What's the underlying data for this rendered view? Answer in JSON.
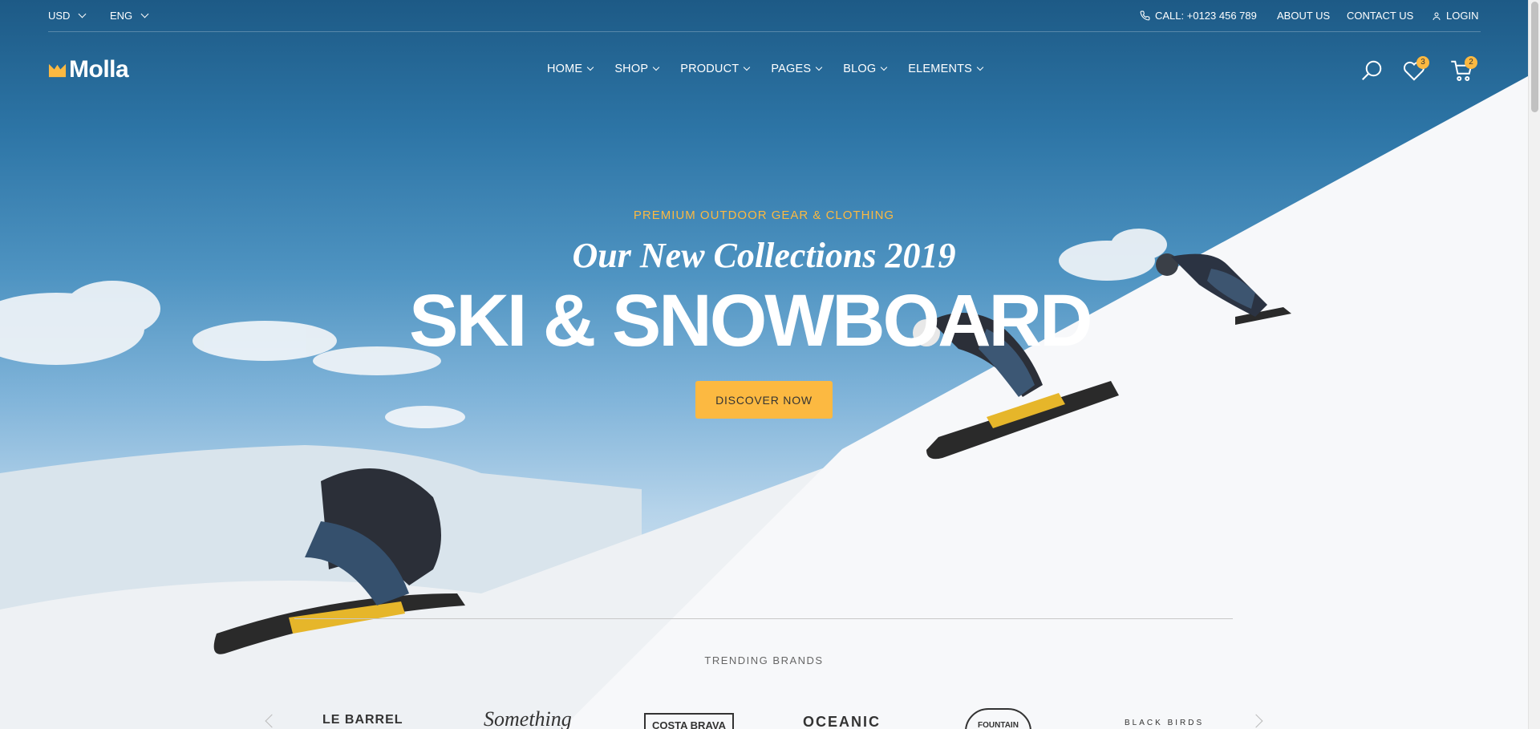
{
  "topbar": {
    "currency": "USD",
    "language": "ENG",
    "phone": "CALL: +0123 456 789",
    "about": "ABOUT US",
    "contact": "CONTACT US",
    "login": "LOGIN"
  },
  "header": {
    "logo_text": "Molla",
    "nav": [
      {
        "label": "HOME"
      },
      {
        "label": "SHOP"
      },
      {
        "label": "PRODUCT"
      },
      {
        "label": "PAGES"
      },
      {
        "label": "BLOG"
      },
      {
        "label": "ELEMENTS"
      }
    ],
    "wishlist_count": "3",
    "cart_count": "2"
  },
  "hero": {
    "eyebrow": "PREMIUM OUTDOOR GEAR & CLOTHING",
    "subtitle": "Our New Collections 2019",
    "headline": "SKI & SNOWBOARD",
    "cta": "DISCOVER NOW"
  },
  "brands": {
    "title": "TRENDING BRANDS",
    "items": [
      "LE BARREL",
      "Something",
      "COSTA BRAVA",
      "OCEANIC",
      "FOUNTAIN",
      "BLACK BIRDS"
    ]
  },
  "colors": {
    "accent": "#fcb941",
    "sky": "#1d5a86"
  },
  "icons": [
    "phone-icon",
    "user-icon",
    "search-icon",
    "heart-icon",
    "cart-icon",
    "chevron-down-icon"
  ]
}
